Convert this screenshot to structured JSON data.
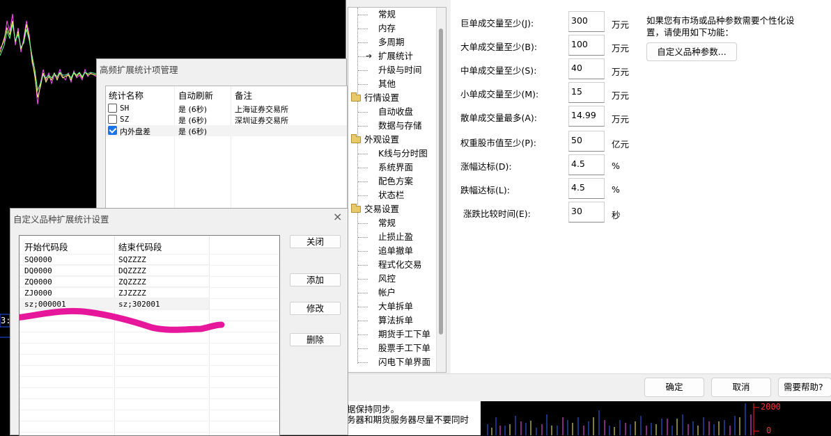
{
  "hf_dialog": {
    "title": "高频扩展统计项管理",
    "columns": [
      "统计名称",
      "自动刷新",
      "备注"
    ],
    "rows": [
      {
        "name": "SH",
        "refresh": "是 (6秒)",
        "note": "上海证券交易所",
        "checked": false
      },
      {
        "name": "SZ",
        "refresh": "是 (6秒)",
        "note": "深圳证券交易所",
        "checked": false
      },
      {
        "name": "内外盘差",
        "refresh": "是 (6秒)",
        "note": "",
        "checked": true
      }
    ]
  },
  "cv_dialog": {
    "title": "自定义品种扩展统计设置",
    "close_icon": "×",
    "columns": [
      "开始代码段",
      "结束代码段"
    ],
    "rows": [
      {
        "start": "SQ0000",
        "end": "SQZZZZ"
      },
      {
        "start": "DQ0000",
        "end": "DQZZZZ"
      },
      {
        "start": "ZQ0000",
        "end": "ZQZZZZ"
      },
      {
        "start": "ZJ0000",
        "end": "ZJZZZZ"
      },
      {
        "start": "sz;000001",
        "end": "sz;302001"
      }
    ],
    "buttons": {
      "close": "关闭",
      "add": "添加",
      "edit": "修改",
      "delete": "删除"
    }
  },
  "settings": {
    "tree": [
      {
        "label": "常规",
        "level": 1
      },
      {
        "label": "内存",
        "level": 1
      },
      {
        "label": "多周期",
        "level": 1
      },
      {
        "label": "扩展统计",
        "level": 1,
        "selected": true
      },
      {
        "label": "升级与时间",
        "level": 1
      },
      {
        "label": "其他",
        "level": 1
      },
      {
        "label": "行情设置",
        "level": 0
      },
      {
        "label": "自动收盘",
        "level": 1
      },
      {
        "label": "数据与存储",
        "level": 1
      },
      {
        "label": "外观设置",
        "level": 0
      },
      {
        "label": "K线与分时图",
        "level": 1
      },
      {
        "label": "系统界面",
        "level": 1
      },
      {
        "label": "配色方案",
        "level": 1
      },
      {
        "label": "状态栏",
        "level": 1
      },
      {
        "label": "交易设置",
        "level": 0
      },
      {
        "label": "常规",
        "level": 1
      },
      {
        "label": "止损止盈",
        "level": 1
      },
      {
        "label": "追单撤单",
        "level": 1
      },
      {
        "label": "程式化交易",
        "level": 1
      },
      {
        "label": "风控",
        "level": 1
      },
      {
        "label": "帐户",
        "level": 1
      },
      {
        "label": "大单拆单",
        "level": 1
      },
      {
        "label": "算法拆单",
        "level": 1
      },
      {
        "label": "期货手工下单",
        "level": 1
      },
      {
        "label": "股票手工下单",
        "level": 1
      },
      {
        "label": "闪电下单界面",
        "level": 1
      }
    ],
    "fields": [
      {
        "label": "巨单成交量至少(J):",
        "value": "300",
        "unit": "万元"
      },
      {
        "label": "大单成交量至少(B):",
        "value": "100",
        "unit": "万元"
      },
      {
        "label": "中单成交量至少(S):",
        "value": "40",
        "unit": "万元"
      },
      {
        "label": "小单成交量至少(M):",
        "value": "15",
        "unit": "万元"
      },
      {
        "label": "散单成交量最多(A):",
        "value": "14.99",
        "unit": "万元"
      },
      {
        "label": "权重股市值至少(P):",
        "value": "50",
        "unit": "亿元"
      },
      {
        "label": "涨幅达标(D):",
        "value": "4.5",
        "unit": "%"
      },
      {
        "label": "跌幅达标(L):",
        "value": "4.5",
        "unit": "%"
      },
      {
        "label": "涨跌比较时间(E):",
        "value": "30",
        "unit": "秒"
      }
    ],
    "hint_line1": "如果您有市场或品种参数需要个性化设",
    "hint_line2": "置，请使用如下功能：",
    "custom_button": "自定义品种参数...",
    "footer": {
      "ok": "确定",
      "cancel": "取消",
      "help": "需要帮助?"
    }
  },
  "background": {
    "notice_line1": "据保持同步。",
    "notice_line2": "务器和期货服务器尽量不要同时",
    "axis_2000": "2000",
    "axis_0": "0",
    "left_marker": "3:"
  }
}
